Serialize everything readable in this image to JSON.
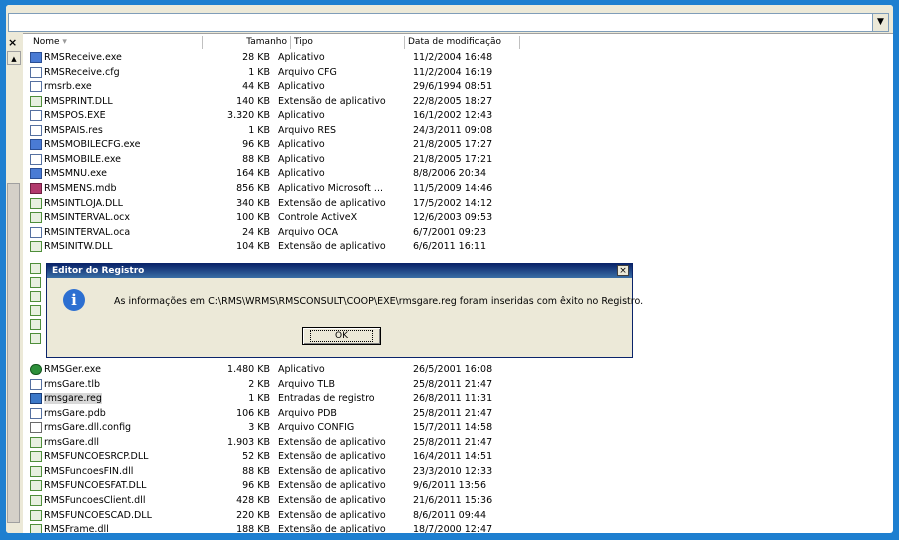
{
  "address": {
    "value": "",
    "dropdown_icon": "chevron-down-icon"
  },
  "left_pane": {
    "close_glyph": "×"
  },
  "columns": {
    "name": "Nome",
    "size": "Tamanho",
    "type": "Tipo",
    "date": "Data de modificação"
  },
  "rows": [
    {
      "name": "RMSReceive.exe",
      "size": "28 KB",
      "type": "Aplicativo",
      "date": "11/2/2004 16:48",
      "icon": "app"
    },
    {
      "name": "RMSReceive.cfg",
      "size": "1 KB",
      "type": "Arquivo CFG",
      "date": "11/2/2004 16:19",
      "icon": "cfg"
    },
    {
      "name": "rmsrb.exe",
      "size": "44 KB",
      "type": "Aplicativo",
      "date": "29/6/1994 08:51",
      "icon": "cfg"
    },
    {
      "name": "RMSPRINT.DLL",
      "size": "140 KB",
      "type": "Extensão de aplicativo",
      "date": "22/8/2005 18:27",
      "icon": "dll"
    },
    {
      "name": "RMSPOS.EXE",
      "size": "3.320 KB",
      "type": "Aplicativo",
      "date": "16/1/2002 12:43",
      "icon": "cfg"
    },
    {
      "name": "RMSPAIS.res",
      "size": "1 KB",
      "type": "Arquivo RES",
      "date": "24/3/2011 09:08",
      "icon": "cfg"
    },
    {
      "name": "RMSMOBILECFG.exe",
      "size": "96 KB",
      "type": "Aplicativo",
      "date": "21/8/2005 17:27",
      "icon": "app"
    },
    {
      "name": "RMSMOBILE.exe",
      "size": "88 KB",
      "type": "Aplicativo",
      "date": "21/8/2005 17:21",
      "icon": "cfg"
    },
    {
      "name": "RMSMNU.exe",
      "size": "164 KB",
      "type": "Aplicativo",
      "date": "8/8/2006 20:34",
      "icon": "app"
    },
    {
      "name": "RMSMENS.mdb",
      "size": "856 KB",
      "type": "Aplicativo Microsoft ...",
      "date": "11/5/2009 14:46",
      "icon": "mdb"
    },
    {
      "name": "RMSINTLOJA.DLL",
      "size": "340 KB",
      "type": "Extensão de aplicativo",
      "date": "17/5/2002 14:12",
      "icon": "dll"
    },
    {
      "name": "RMSINTERVAL.ocx",
      "size": "100 KB",
      "type": "Controle ActiveX",
      "date": "12/6/2003 09:53",
      "icon": "dll"
    },
    {
      "name": "RMSINTERVAL.oca",
      "size": "24 KB",
      "type": "Arquivo OCA",
      "date": "6/7/2001 09:23",
      "icon": "cfg"
    },
    {
      "name": "RMSINITW.DLL",
      "size": "104 KB",
      "type": "Extensão de aplicativo",
      "date": "6/6/2011 16:11",
      "icon": "dll"
    },
    {
      "name": "RMSGer.exe",
      "size": "1.480 KB",
      "type": "Aplicativo",
      "date": "26/5/2001 16:08",
      "icon": "glob"
    },
    {
      "name": "rmsGare.tlb",
      "size": "2 KB",
      "type": "Arquivo TLB",
      "date": "25/8/2011 21:47",
      "icon": "cfg"
    },
    {
      "name": "rmsgare.reg",
      "size": "1 KB",
      "type": "Entradas de registro",
      "date": "26/8/2011 11:31",
      "icon": "reg",
      "selected": true
    },
    {
      "name": "rmsGare.pdb",
      "size": "106 KB",
      "type": "Arquivo PDB",
      "date": "25/8/2011 21:47",
      "icon": "cfg"
    },
    {
      "name": "rmsGare.dll.config",
      "size": "3 KB",
      "type": "Arquivo CONFIG",
      "date": "15/7/2011 14:58",
      "icon": "doc"
    },
    {
      "name": "rmsGare.dll",
      "size": "1.903 KB",
      "type": "Extensão de aplicativo",
      "date": "25/8/2011 21:47",
      "icon": "dll"
    },
    {
      "name": "RMSFUNCOESRCP.DLL",
      "size": "52 KB",
      "type": "Extensão de aplicativo",
      "date": "16/4/2011 14:51",
      "icon": "dll"
    },
    {
      "name": "RMSFuncoesFIN.dll",
      "size": "88 KB",
      "type": "Extensão de aplicativo",
      "date": "23/3/2010 12:33",
      "icon": "dll"
    },
    {
      "name": "RMSFUNCOESFAT.DLL",
      "size": "96 KB",
      "type": "Extensão de aplicativo",
      "date": "9/6/2011 13:56",
      "icon": "dll"
    },
    {
      "name": "RMSFuncoesClient.dll",
      "size": "428 KB",
      "type": "Extensão de aplicativo",
      "date": "21/6/2011 15:36",
      "icon": "dll"
    },
    {
      "name": "RMSFUNCOESCAD.DLL",
      "size": "220 KB",
      "type": "Extensão de aplicativo",
      "date": "8/6/2011 09:44",
      "icon": "dll"
    },
    {
      "name": "RMSFrame.dll",
      "size": "188 KB",
      "type": "Extensão de aplicativo",
      "date": "18/7/2000 12:47",
      "icon": "dll"
    }
  ],
  "dialog": {
    "title": "Editor do Registro",
    "message": "As informações em C:\\RMS\\WRMS\\RMSCONSULT\\COOP\\EXE\\rmsgare.reg foram inseridas com êxito no Registro.",
    "ok_label": "OK",
    "close_glyph": "×",
    "icon": "info-icon"
  }
}
